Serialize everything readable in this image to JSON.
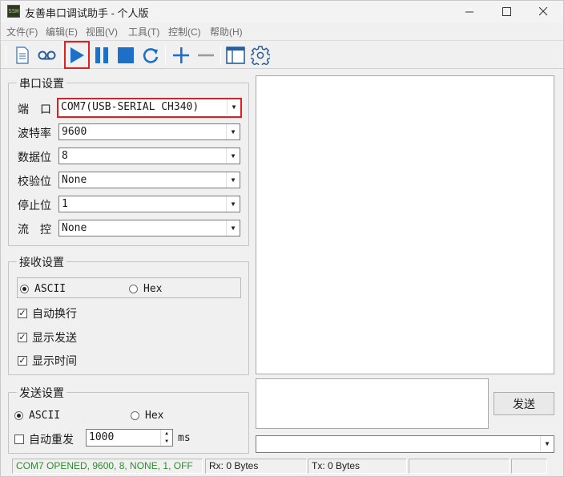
{
  "window": {
    "title": "友善串口调试助手 - 个人版",
    "icon_text": "SSH"
  },
  "menu": [
    "文件(F)",
    "编辑(E)",
    "视图(V)",
    "工具(T)",
    "控制(C)",
    "帮助(H)"
  ],
  "toolbar": {
    "icons": [
      "document-icon",
      "record-icon",
      "play-icon",
      "pause-icon",
      "stop-icon",
      "refresh-icon",
      "plus-icon",
      "minus-icon",
      "window-icon",
      "gear-icon"
    ],
    "highlighted": "play-icon",
    "accent": "#1e6fc7"
  },
  "serial": {
    "title": "串口设置",
    "rows": [
      {
        "label": "端　口",
        "value": "COM7(USB-SERIAL CH340)"
      },
      {
        "label": "波特率",
        "value": "9600"
      },
      {
        "label": "数据位",
        "value": "8"
      },
      {
        "label": "校验位",
        "value": "None"
      },
      {
        "label": "停止位",
        "value": "1"
      },
      {
        "label": "流　控",
        "value": "None"
      }
    ]
  },
  "receive": {
    "title": "接收设置",
    "ascii": "ASCII",
    "hex": "Hex",
    "selected": "ASCII",
    "checks": [
      {
        "label": "自动换行",
        "checked": true
      },
      {
        "label": "显示发送",
        "checked": true
      },
      {
        "label": "显示时间",
        "checked": true
      }
    ]
  },
  "send": {
    "title": "发送设置",
    "ascii": "ASCII",
    "hex": "Hex",
    "selected": "ASCII",
    "auto_resend": {
      "label": "自动重发",
      "checked": false
    },
    "interval": "1000",
    "unit": "ms",
    "button": "发送"
  },
  "status": {
    "port": "COM7 OPENED, 9600, 8, NONE, 1, OFF",
    "port_color": "#2e8b2e",
    "rx": "Rx: 0 Bytes",
    "tx": "Tx: 0 Bytes"
  }
}
